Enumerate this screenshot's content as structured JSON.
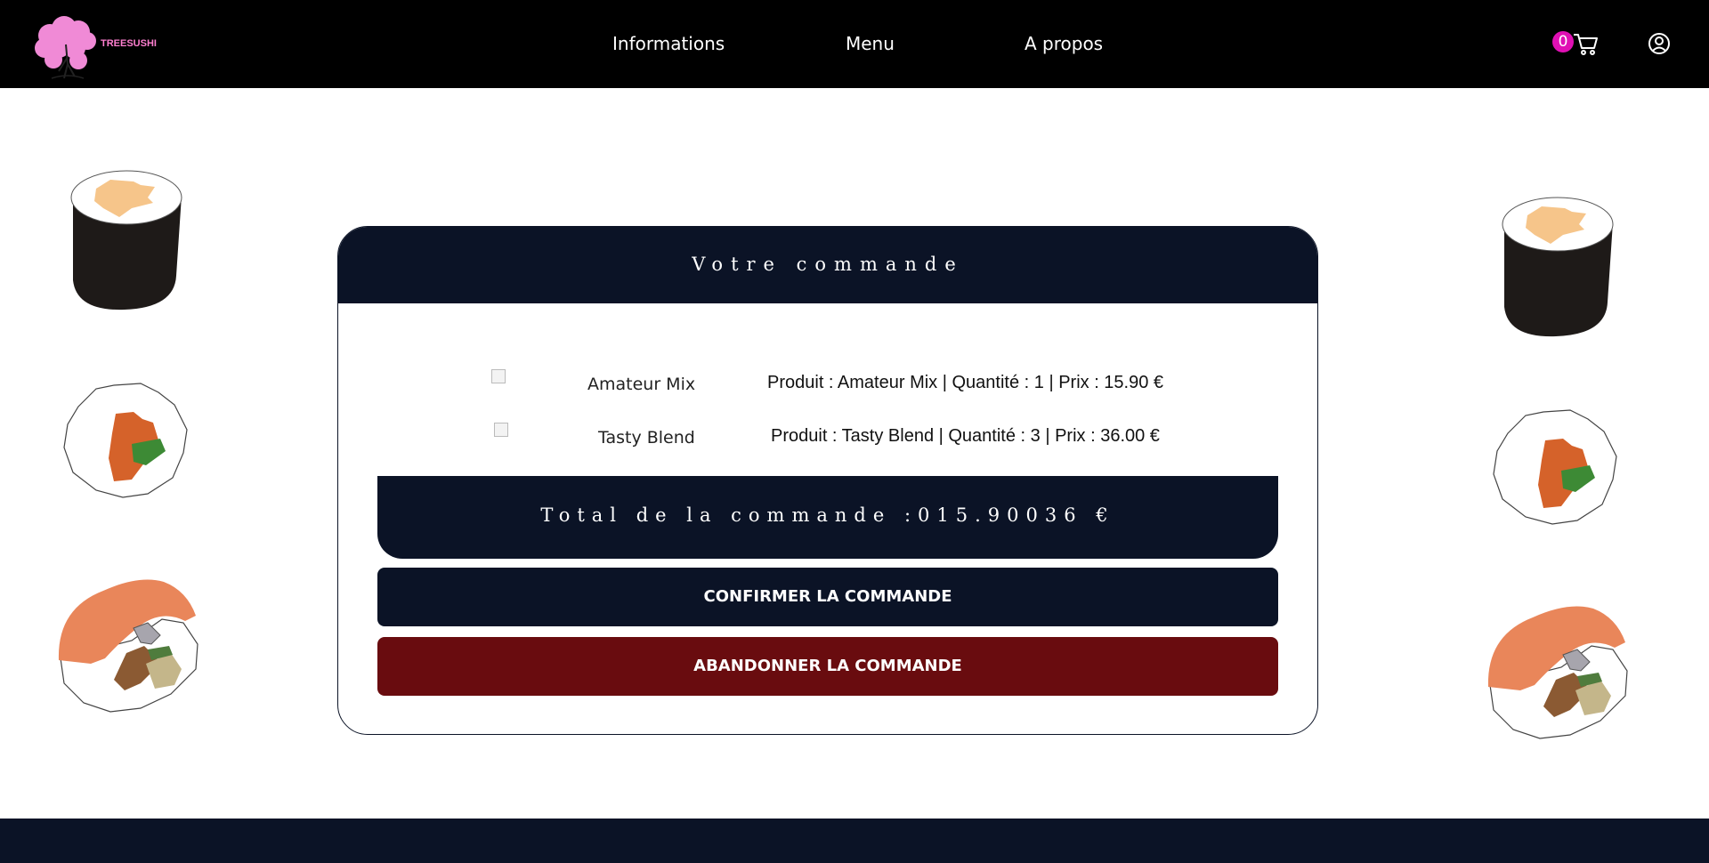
{
  "brand": {
    "logo_text": "TREESUSHI"
  },
  "nav": {
    "informations": "Informations",
    "menu": "Menu",
    "apropos": "A propos"
  },
  "cart": {
    "count": "0",
    "icon": "cart-icon"
  },
  "account": {
    "icon": "user-icon"
  },
  "order": {
    "title": "Votre commande",
    "items": [
      {
        "name": "Amateur Mix",
        "description": "Produit : Amateur Mix | Quantité : 1 | Prix : 15.90 €"
      },
      {
        "name": "Tasty Blend",
        "description": "Produit : Tasty Blend | Quantité : 3 | Prix : 36.00 €"
      }
    ],
    "total_label": "Total de la commande :015.90036 €",
    "confirm_label": "CONFIRMER LA COMMANDE",
    "cancel_label": "ABANDONNER LA COMMANDE"
  },
  "colors": {
    "navy": "#0b1326",
    "cancel_red": "#690c0f",
    "badge_pink": "#e010b4",
    "logo_pink": "#ff7fd0"
  }
}
